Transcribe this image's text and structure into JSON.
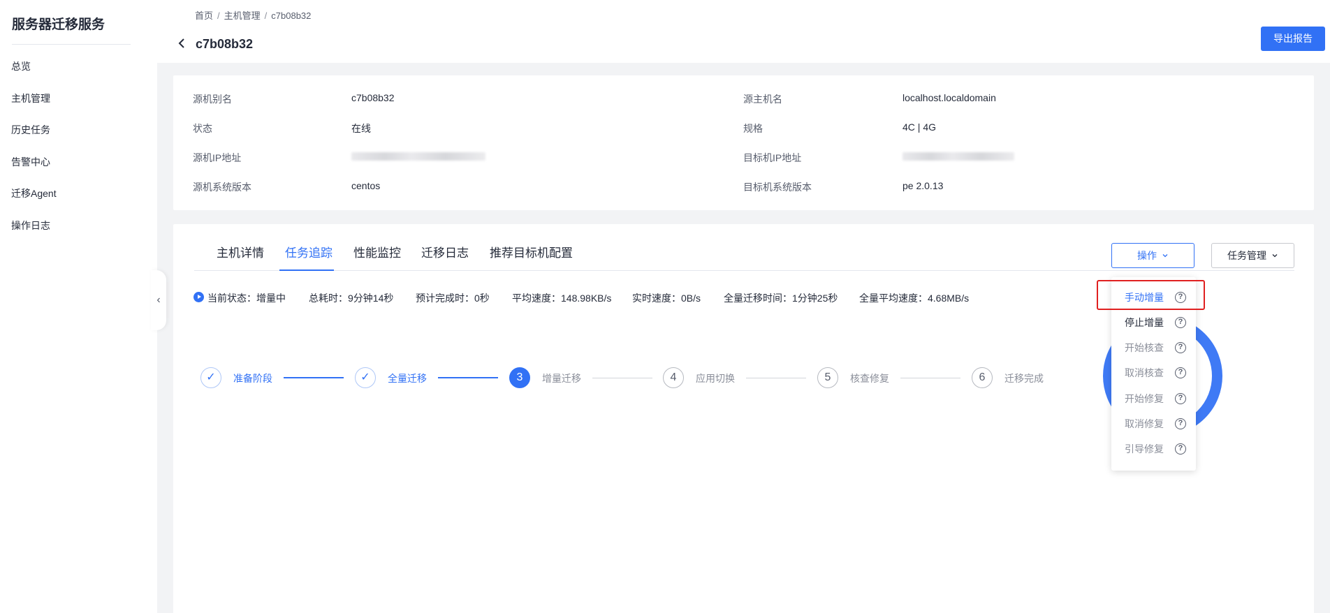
{
  "sidebar": {
    "title": "服务器迁移服务",
    "items": [
      {
        "label": "总览"
      },
      {
        "label": "主机管理"
      },
      {
        "label": "历史任务"
      },
      {
        "label": "告警中心"
      },
      {
        "label": "迁移Agent"
      },
      {
        "label": "操作日志"
      }
    ]
  },
  "header": {
    "breadcrumb": [
      "首页",
      "主机管理",
      "c7b08b32"
    ],
    "breadcrumb_separator": "/",
    "title": "c7b08b32",
    "export_label": "导出报告"
  },
  "info": {
    "left": [
      {
        "label": "源机别名",
        "value": "c7b08b32"
      },
      {
        "label": "状态",
        "value": "在线"
      },
      {
        "label": "源机IP地址",
        "value": ""
      },
      {
        "label": "源机系统版本",
        "value": "centos"
      }
    ],
    "right": [
      {
        "label": "源主机名",
        "value": "localhost.localdomain"
      },
      {
        "label": "规格",
        "value": "4C | 4G"
      },
      {
        "label": "目标机IP地址",
        "value": ""
      },
      {
        "label": "目标机系统版本",
        "value": "pe 2.0.13"
      }
    ]
  },
  "tabs": [
    {
      "label": "主机详情"
    },
    {
      "label": "任务追踪",
      "active": true
    },
    {
      "label": "性能监控"
    },
    {
      "label": "迁移日志"
    },
    {
      "label": "推荐目标机配置"
    }
  ],
  "actions": {
    "operate_label": "操作",
    "task_label": "任务管理",
    "chevron": "chevron-down-icon"
  },
  "status": {
    "current": "当前状态：增量中",
    "total_time": "总耗时：9分钟14秒",
    "eta": "预计完成时：0秒",
    "avg_speed": "平均速度：148.98KB/s",
    "realtime_speed": "实时速度：0B/s",
    "full_time": "全量迁移时间：1分钟25秒",
    "full_avg_speed": "全量平均速度：4.68MB/s"
  },
  "steps": [
    {
      "marker": "✓",
      "label": "准备阶段",
      "state": "done"
    },
    {
      "marker": "✓",
      "label": "全量迁移",
      "state": "done"
    },
    {
      "marker": "3",
      "label": "增量迁移",
      "state": "current"
    },
    {
      "marker": "4",
      "label": "应用切换",
      "state": "pending"
    },
    {
      "marker": "5",
      "label": "核查修复",
      "state": "pending"
    },
    {
      "marker": "6",
      "label": "迁移完成",
      "state": "pending"
    }
  ],
  "dropdown": {
    "help_glyph": "?",
    "items": [
      {
        "label": "手动增量",
        "state": "active"
      },
      {
        "label": "停止增量",
        "state": "enabled"
      },
      {
        "label": "开始核查",
        "state": "disabled"
      },
      {
        "label": "取消核查",
        "state": "disabled"
      },
      {
        "label": "开始修复",
        "state": "disabled"
      },
      {
        "label": "取消修复",
        "state": "disabled"
      },
      {
        "label": "引导修复",
        "state": "disabled"
      }
    ]
  },
  "colors": {
    "accent": "#3171f5",
    "highlight": "#e02020"
  }
}
